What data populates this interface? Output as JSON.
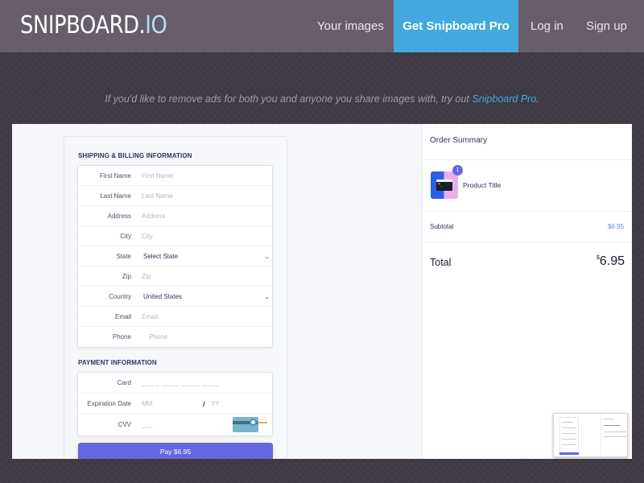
{
  "nav": {
    "logo_main": "SNIPBOARD.",
    "logo_accent": "IO",
    "your_images": "Your images",
    "get_pro": "Get Snipboard Pro",
    "login": "Log in",
    "signup": "Sign up"
  },
  "banner": {
    "text": "If you'd like to remove ads for both you and anyone you share images with, try out ",
    "link": "Snipboard Pro",
    "end": "."
  },
  "checkout": {
    "shipping_title": "SHIPPING & BILLING INFORMATION",
    "fields": {
      "first_name": {
        "label": "First Name",
        "placeholder": "First Name"
      },
      "last_name": {
        "label": "Last Name",
        "placeholder": "Last Name"
      },
      "address": {
        "label": "Address",
        "placeholder": "Address"
      },
      "city": {
        "label": "City",
        "placeholder": "City"
      },
      "state": {
        "label": "State",
        "value": "Select State"
      },
      "zip": {
        "label": "Zip",
        "placeholder": "Zip"
      },
      "country": {
        "label": "Country",
        "value": "United States"
      },
      "email": {
        "label": "Email",
        "placeholder": "Email"
      },
      "phone": {
        "label": "Phone",
        "placeholder": "Phone"
      }
    },
    "payment_title": "PAYMENT INFORMATION",
    "payment": {
      "card_label": "Card",
      "card_placeholder": "____ ____ ____ ____",
      "expiration_label": "Expiration Date",
      "month_placeholder": "MM",
      "separator": "/",
      "year_placeholder": "YY",
      "cvv_label": "CVV",
      "cvv_placeholder": "___"
    },
    "pay_button": "Pay $6.95",
    "accent_color": "#6666e0"
  },
  "summary": {
    "title": "Order Summary",
    "quantity": "1",
    "product_title": "Product Title",
    "subtotal_label": "Subtotal",
    "subtotal_value": "$6.95",
    "total_label": "Total",
    "total_currency": "$",
    "total_value": "6.95"
  },
  "icons": {
    "product_thumbnail": "terminal-window-icon",
    "select_caret": "chevron-down-icon",
    "cvv_card": "credit-card-back-icon"
  },
  "colors": {
    "topbar": "#685e6b",
    "pro_button": "#41a9dd",
    "background": "#403a44"
  }
}
